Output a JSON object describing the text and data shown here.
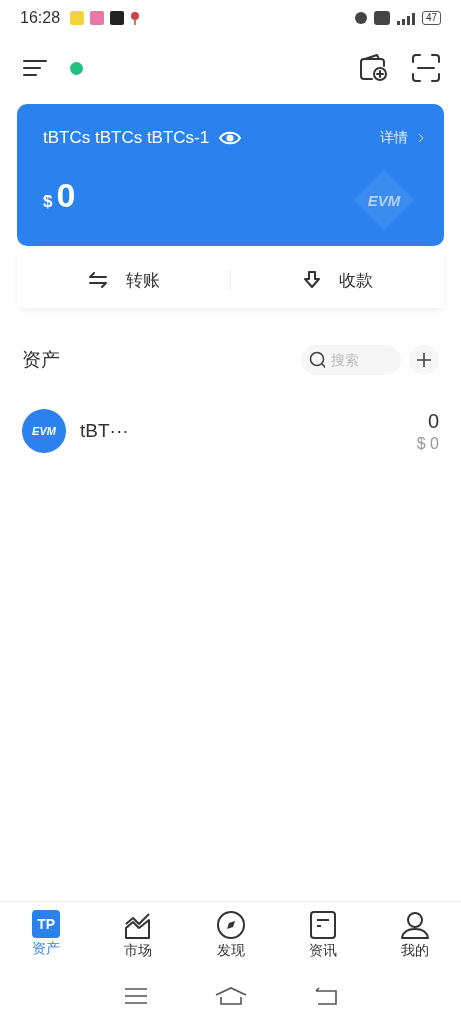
{
  "status_bar": {
    "time": "16:28",
    "battery": "47"
  },
  "header": {
    "connected": true
  },
  "wallet": {
    "name": "tBTCs tBTCs tBTCs-1",
    "details": "详情",
    "currency": "$",
    "balance": "0",
    "watermark": "EVM"
  },
  "actions": [
    {
      "kind": "transfer",
      "label": "转账"
    },
    {
      "kind": "receive",
      "label": "收款"
    }
  ],
  "assets": {
    "title": "资产",
    "search": {
      "placeholder": "搜索"
    },
    "items": [
      {
        "logo": "EVM",
        "name": "tBT···",
        "amount": "0",
        "value": "$ 0"
      }
    ]
  },
  "tabs": [
    {
      "kind": "assets",
      "label": "资产",
      "selected": true,
      "logo": "TP"
    },
    {
      "kind": "market",
      "label": "市场",
      "selected": false
    },
    {
      "kind": "discover",
      "label": "发现",
      "selected": false
    },
    {
      "kind": "news",
      "label": "资讯",
      "selected": false
    },
    {
      "kind": "me",
      "label": "我的",
      "selected": false
    }
  ]
}
